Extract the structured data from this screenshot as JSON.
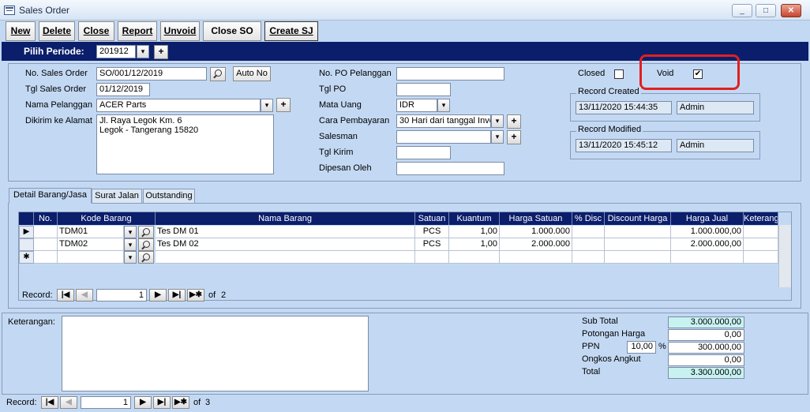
{
  "window": {
    "title": "Sales Order",
    "minimize": "0",
    "maximize": "1",
    "close": "X"
  },
  "toolbar": {
    "new": "New",
    "delete": "Delete",
    "close": "Close",
    "report": "Report",
    "unvoid": "Unvoid",
    "close_so": "Close SO",
    "create_sj": "Create SJ"
  },
  "period": {
    "label": "Pilih Periode:",
    "value": "201912",
    "plus": "+"
  },
  "form": {
    "no_so_label": "No. Sales Order",
    "no_so_value": "SO/001/12/2019",
    "auto_no": "Auto No",
    "tgl_so_label": "Tgl Sales Order",
    "tgl_so_value": "01/12/2019",
    "pelanggan_label": "Nama Pelanggan",
    "pelanggan_value": "ACER Parts",
    "alamat_label": "Dikirim ke Alamat",
    "alamat_line1": "Jl. Raya Legok Km. 6",
    "alamat_line2": "Legok - Tangerang 15820",
    "po_label": "No. PO Pelanggan",
    "po_value": "",
    "tgl_po_label": "Tgl PO",
    "tgl_po_value": "",
    "mata_uang_label": "Mata Uang",
    "mata_uang_value": "IDR",
    "cara_bayar_label": "Cara Pembayaran",
    "cara_bayar_value": "30 Hari dari tanggal Invo",
    "salesman_label": "Salesman",
    "salesman_value": "",
    "tgl_kirim_label": "Tgl Kirim",
    "tgl_kirim_value": "",
    "dipesan_label": "Dipesan Oleh",
    "dipesan_value": "",
    "closed_label": "Closed",
    "closed_checked": "",
    "void_label": "Void",
    "void_checked": "✔",
    "created_title": "Record Created",
    "created_date": "13/11/2020 15:44:35",
    "created_user": "Admin",
    "modified_title": "Record Modified",
    "modified_date": "13/11/2020 15:45:12",
    "modified_user": "Admin"
  },
  "tabs": [
    "Detail Barang/Jasa",
    "Surat Jalan",
    "Outstanding"
  ],
  "grid": {
    "headers": [
      "No.",
      "Kode Barang",
      "Nama Barang",
      "Satuan",
      "Kuantum",
      "Harga Satuan",
      "% Disc",
      "Discount Harga",
      "Harga Jual",
      "Keterangan"
    ],
    "rows": [
      {
        "no": "",
        "kode": "TDM01",
        "nama": "Tes DM 01",
        "satuan": "PCS",
        "kuantum": "1,00",
        "harga": "1.000.000",
        "disc": "",
        "disc_harga": "",
        "jual": "1.000.000,00",
        "ket": ""
      },
      {
        "no": "",
        "kode": "TDM02",
        "nama": "Tes DM 02",
        "satuan": "PCS",
        "kuantum": "1,00",
        "harga": "2.000.000",
        "disc": "",
        "disc_harga": "",
        "jual": "2.000.000,00",
        "ket": ""
      }
    ],
    "new_row_marker": "✱",
    "current_marker": "▶",
    "nav": {
      "label": "Record:",
      "current": "1",
      "of": "of",
      "total": "2"
    }
  },
  "footer": {
    "keterangan_label": "Keterangan:",
    "sub_total_label": "Sub Total",
    "sub_total": "3.000.000,00",
    "potongan_label": "Potongan Harga",
    "potongan": "0,00",
    "ppn_label": "PPN",
    "ppn_pct": "10,00",
    "pct_sign": "%",
    "ppn": "300.000,00",
    "ongkos_label": "Ongkos Angkut",
    "ongkos": "0,00",
    "total_label": "Total",
    "total": "3.300.000,00"
  },
  "bottom_nav": {
    "label": "Record:",
    "current": "1",
    "of": "of",
    "total": "3"
  },
  "nav_glyphs": {
    "first": "|◀",
    "prev": "◀",
    "next": "▶",
    "last": "▶|",
    "new": "▶✱"
  },
  "combo_glyph": "▾"
}
